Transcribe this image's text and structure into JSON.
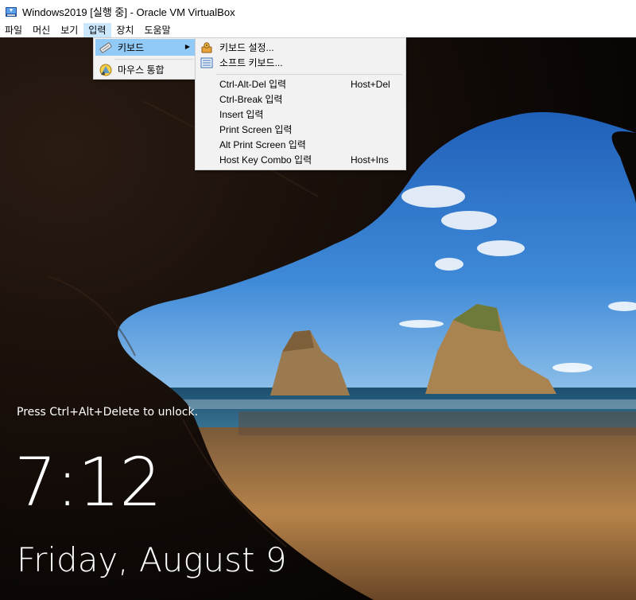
{
  "window": {
    "title": "Windows2019 [실행 중] - Oracle VM VirtualBox"
  },
  "menubar": {
    "items": [
      {
        "label": "파일"
      },
      {
        "label": "머신"
      },
      {
        "label": "보기"
      },
      {
        "label": "입력"
      },
      {
        "label": "장치"
      },
      {
        "label": "도움말"
      }
    ]
  },
  "input_menu": {
    "items": [
      {
        "label": "키보드",
        "icon": "keyboard-icon",
        "has_submenu": true
      },
      {
        "label": "마우스 통합",
        "icon": "mouse-integration-icon"
      }
    ]
  },
  "keyboard_submenu": {
    "items": [
      {
        "label": "키보드 설정...",
        "icon": "keyboard-settings-icon",
        "shortcut": ""
      },
      {
        "label": "소프트 키보드...",
        "icon": "soft-keyboard-icon",
        "shortcut": ""
      },
      {
        "label": "Ctrl-Alt-Del 입력",
        "shortcut": "Host+Del"
      },
      {
        "label": "Ctrl-Break 입력",
        "shortcut": ""
      },
      {
        "label": "Insert 입력",
        "shortcut": ""
      },
      {
        "label": "Print Screen 입력",
        "shortcut": ""
      },
      {
        "label": "Alt Print Screen 입력",
        "shortcut": ""
      },
      {
        "label": "Host Key Combo 입력",
        "shortcut": "Host+Ins"
      }
    ]
  },
  "lockscreen": {
    "message": "Press Ctrl+Alt+Delete to unlock.",
    "time": "7:12",
    "date": "Friday, August 9"
  },
  "colors": {
    "menu_highlight": "#91c9f7",
    "menubar_open": "#cce8ff",
    "menu_bg": "#f2f2f2"
  }
}
